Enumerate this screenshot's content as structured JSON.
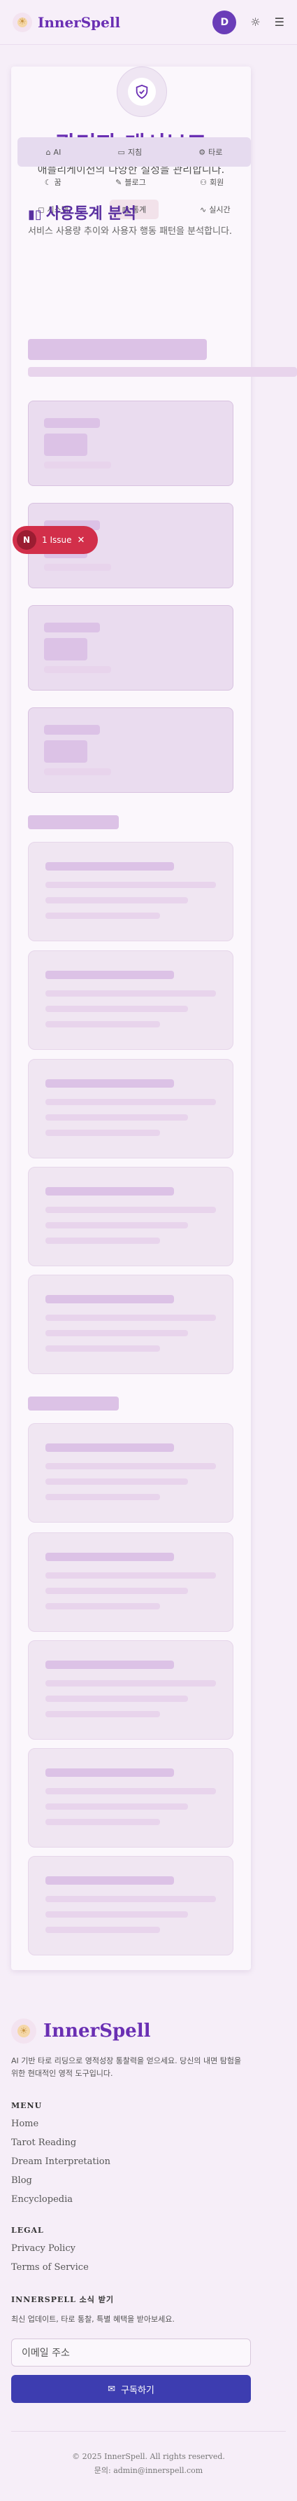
{
  "header": {
    "logo_text": "InnerSpell",
    "avatar_initial": "D"
  },
  "page": {
    "title": "관리자 대시보드",
    "subtitle": "애플리케이션의 다양한 설정을 관리합니다."
  },
  "tabs": {
    "row1": [
      {
        "label": "AI",
        "icon": "ai-icon"
      },
      {
        "label": "지침",
        "icon": "book-icon"
      },
      {
        "label": "타로",
        "icon": "tarot-icon"
      }
    ],
    "row2": [
      {
        "label": "꿈",
        "icon": "moon-icon"
      },
      {
        "label": "블로그",
        "icon": "blog-icon"
      },
      {
        "label": "회원",
        "icon": "users-icon"
      }
    ],
    "row3": [
      {
        "label": "시스템",
        "icon": "system-icon"
      },
      {
        "label": "통계",
        "icon": "chart-icon"
      },
      {
        "label": "실시간",
        "icon": "pulse-icon"
      }
    ]
  },
  "section": {
    "title": "사용통계 분석",
    "subtitle": "서비스 사용량 추이와 사용자 행동 패턴을 분석합니다."
  },
  "issue": {
    "count_icon": "N",
    "label": "1 Issue"
  },
  "footer": {
    "logo_text": "InnerSpell",
    "description": "AI 기반 타로 리딩으로 영적성장 통찰력을 얻으세요. 당신의 내면 탐험을 위한 현대적인 영적 도구입니다.",
    "menu_heading": "MENU",
    "menu": [
      "Home",
      "Tarot Reading",
      "Dream Interpretation",
      "Blog",
      "Encyclopedia"
    ],
    "legal_heading": "LEGAL",
    "legal": [
      "Privacy Policy",
      "Terms of Service"
    ],
    "newsletter_heading": "INNERSPELL 소식 받기",
    "newsletter_desc": "최신 업데이트, 타로 통찰, 특별 혜택을 받아보세요.",
    "email_placeholder": "이메일 주소",
    "subscribe_label": "구독하기",
    "copyright": "© 2025 InnerSpell. All rights reserved.",
    "contact": "문의: admin@innerspell.com"
  }
}
